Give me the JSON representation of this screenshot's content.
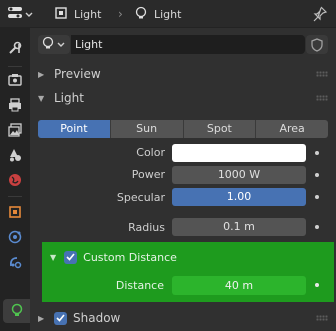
{
  "header": {
    "editor_icon": "properties-editor-icon",
    "crumb_object_label": "Light",
    "crumb_object_icon": "object-data-icon",
    "separator": "›",
    "crumb_data_label": "Light",
    "crumb_data_icon": "light-bulb-icon",
    "pin_icon": "pin-icon"
  },
  "tabs": [
    {
      "name": "tab-tool",
      "icon": "wrench-screwdriver-icon",
      "active": false
    },
    {
      "name": "tab-render",
      "icon": "camera-back-icon",
      "active": false
    },
    {
      "name": "tab-output",
      "icon": "printer-icon",
      "active": false
    },
    {
      "name": "tab-view-layer",
      "icon": "image-stack-icon",
      "active": false
    },
    {
      "name": "tab-scene",
      "icon": "scene-cone-icon",
      "active": false
    },
    {
      "name": "tab-world",
      "icon": "world-globe-icon",
      "active": false
    },
    {
      "name": "tab-object",
      "icon": "object-square-icon",
      "active": false
    },
    {
      "name": "tab-physics",
      "icon": "physics-orbit-icon",
      "active": false
    },
    {
      "name": "tab-constraints",
      "icon": "constraint-icon",
      "active": false
    },
    {
      "name": "tab-light-data",
      "icon": "light-bulb-icon",
      "active": true
    }
  ],
  "datablock": {
    "value": "Light",
    "icon": "light-bulb-icon",
    "shield_icon": "fake-user-shield-icon"
  },
  "panels": {
    "preview": {
      "label": "Preview",
      "expanded": false
    },
    "light": {
      "label": "Light",
      "expanded": true
    },
    "shadow": {
      "label": "Shadow",
      "expanded": false,
      "checked": true
    }
  },
  "light_types": [
    {
      "label": "Point",
      "selected": true
    },
    {
      "label": "Sun",
      "selected": false
    },
    {
      "label": "Spot",
      "selected": false
    },
    {
      "label": "Area",
      "selected": false
    }
  ],
  "properties": {
    "color_label": "Color",
    "color_value": "#ffffff",
    "power_label": "Power",
    "power_value": "1000 W",
    "specular_label": "Specular",
    "specular_value": "1.00",
    "specular_fill": 1.0,
    "radius_label": "Radius",
    "radius_value": "0.1 m"
  },
  "custom_distance": {
    "label": "Custom Distance",
    "checked": true,
    "distance_label": "Distance",
    "distance_value": "40 m"
  },
  "colors": {
    "accent_blue": "#4772b3",
    "highlight_green": "#1e9b1e",
    "highlight_green_field": "#2cb42c",
    "panel_bg": "#303030"
  }
}
